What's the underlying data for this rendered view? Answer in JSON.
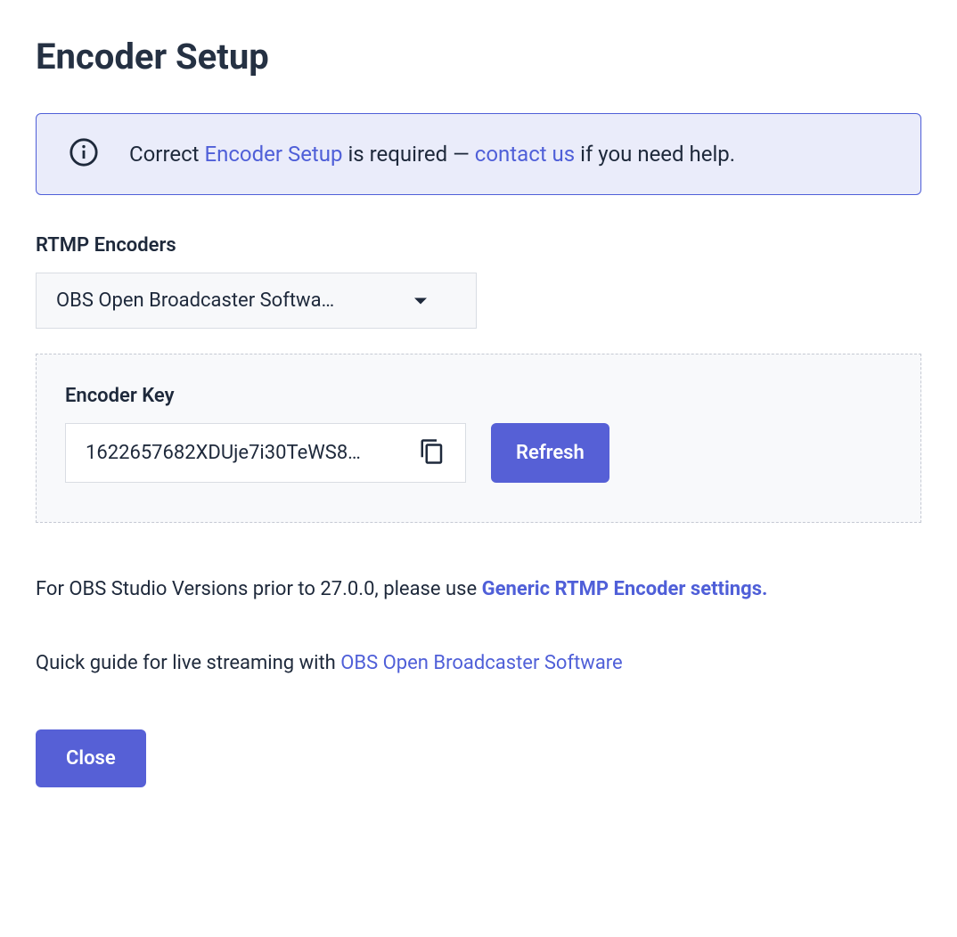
{
  "page_title": "Encoder Setup",
  "banner": {
    "prefix": "Correct ",
    "link1": "Encoder Setup",
    "mid": " is required — ",
    "link2": "contact us",
    "suffix": " if you need help."
  },
  "encoders": {
    "label": "RTMP Encoders",
    "selected": "OBS Open Broadcaster Softwa…"
  },
  "key_panel": {
    "label": "Encoder Key",
    "value": "1622657682XDUje7i30TeWS8…",
    "refresh_label": "Refresh"
  },
  "note1": {
    "prefix": "For OBS Studio Versions prior to 27.0.0, please use ",
    "link": "Generic RTMP Encoder settings."
  },
  "note2": {
    "prefix": "Quick guide for live streaming with ",
    "link": "OBS Open Broadcaster Software"
  },
  "close_label": "Close"
}
